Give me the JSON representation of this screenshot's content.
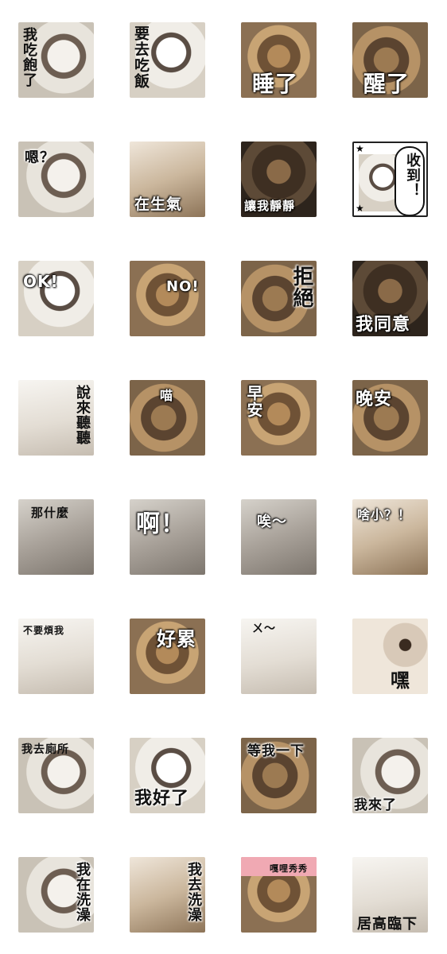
{
  "stickers": [
    {
      "caption": "我吃飽了"
    },
    {
      "caption": "要去吃飯"
    },
    {
      "caption": "睡了"
    },
    {
      "caption": "醒了"
    },
    {
      "caption": "嗯？"
    },
    {
      "caption": "在生氣"
    },
    {
      "caption": "讓我靜靜"
    },
    {
      "caption": "收到！"
    },
    {
      "caption": "OK!"
    },
    {
      "caption": "NO!"
    },
    {
      "caption": "拒絕"
    },
    {
      "caption": "我同意"
    },
    {
      "caption": "說來聽聽"
    },
    {
      "caption": "喵"
    },
    {
      "caption": "早安"
    },
    {
      "caption": "晚安"
    },
    {
      "caption": "那什麼"
    },
    {
      "caption": "啊！"
    },
    {
      "caption": "唉～"
    },
    {
      "caption": "啥小？！"
    },
    {
      "caption": "不要煩我"
    },
    {
      "caption": "好累"
    },
    {
      "caption": "ㄨ～"
    },
    {
      "caption": "嘿"
    },
    {
      "caption": "我去廁所"
    },
    {
      "caption": "我好了"
    },
    {
      "caption": "等我一下"
    },
    {
      "caption": "我來了"
    },
    {
      "caption": "我在洗澡"
    },
    {
      "caption": "我去洗澡"
    },
    {
      "caption": "嘎哩秀秀"
    },
    {
      "caption": "居高臨下"
    }
  ]
}
